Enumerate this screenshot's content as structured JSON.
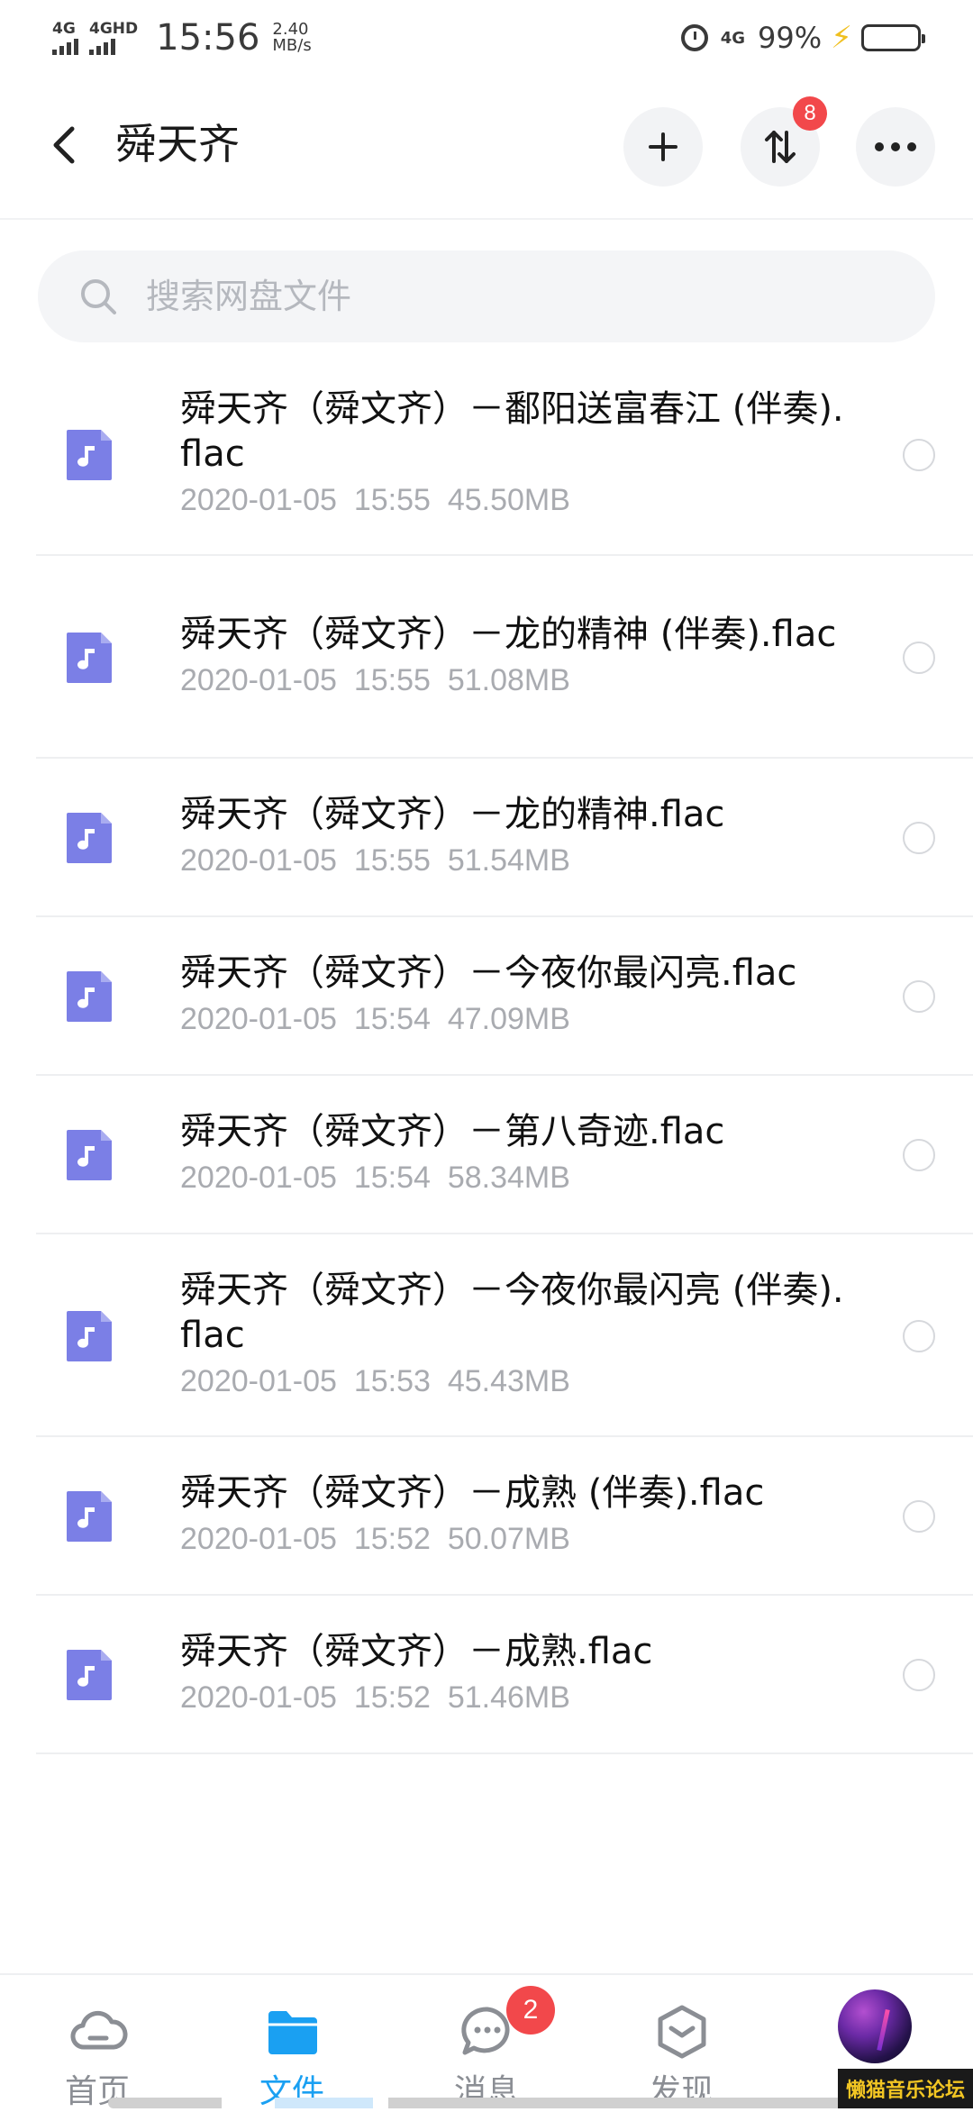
{
  "status_bar": {
    "network1": "4G",
    "network2": "4GHD",
    "time": "15:56",
    "speed_value": "2.40",
    "speed_unit": "MB/s",
    "network_right": "4G",
    "battery_percent": "99%",
    "battery_level": 0.99,
    "battery_color": "#2fc22f"
  },
  "header": {
    "title": "舜天齐",
    "sort_badge": "8"
  },
  "search": {
    "placeholder": "搜索网盘文件"
  },
  "files": [
    {
      "name": "舜天齐（舜文齐）－鄱阳送富春江 (伴奏).flac",
      "date": "2020-01-05",
      "time": "15:55",
      "size": "45.50MB",
      "icon": "music-file-icon"
    },
    {
      "name": "舜天齐（舜文齐）－龙的精神 (伴奏).flac",
      "date": "2020-01-05",
      "time": "15:55",
      "size": "51.08MB",
      "icon": "music-file-icon"
    },
    {
      "name": "舜天齐（舜文齐）－龙的精神.flac",
      "date": "2020-01-05",
      "time": "15:55",
      "size": "51.54MB",
      "icon": "music-file-icon"
    },
    {
      "name": "舜天齐（舜文齐）－今夜你最闪亮.flac",
      "date": "2020-01-05",
      "time": "15:54",
      "size": "47.09MB",
      "icon": "music-file-icon"
    },
    {
      "name": "舜天齐（舜文齐）－第八奇迹.flac",
      "date": "2020-01-05",
      "time": "15:54",
      "size": "58.34MB",
      "icon": "music-file-icon"
    },
    {
      "name": "舜天齐（舜文齐）－今夜你最闪亮 (伴奏).flac",
      "date": "2020-01-05",
      "time": "15:53",
      "size": "45.43MB",
      "icon": "music-file-icon"
    },
    {
      "name": "舜天齐（舜文齐）－成熟 (伴奏).flac",
      "date": "2020-01-05",
      "time": "15:52",
      "size": "50.07MB",
      "icon": "music-file-icon"
    },
    {
      "name": "舜天齐（舜文齐）－成熟.flac",
      "date": "2020-01-05",
      "time": "15:52",
      "size": "51.46MB",
      "icon": "music-file-icon"
    }
  ],
  "bottom_nav": {
    "items": [
      {
        "label": "首页",
        "icon": "cloud-icon"
      },
      {
        "label": "文件",
        "icon": "folder-icon",
        "active": true
      },
      {
        "label": "消息",
        "icon": "chat-bubble-icon",
        "badge": "2"
      },
      {
        "label": "发现",
        "icon": "discover-cube-icon"
      },
      {
        "label": "",
        "icon": "avatar"
      }
    ]
  },
  "watermark": "懒猫音乐论坛",
  "colors": {
    "accent": "#1aa0f2",
    "file_icon": "#7b7fe6",
    "badge": "#f2484b",
    "meta_text": "#a9abb0"
  }
}
